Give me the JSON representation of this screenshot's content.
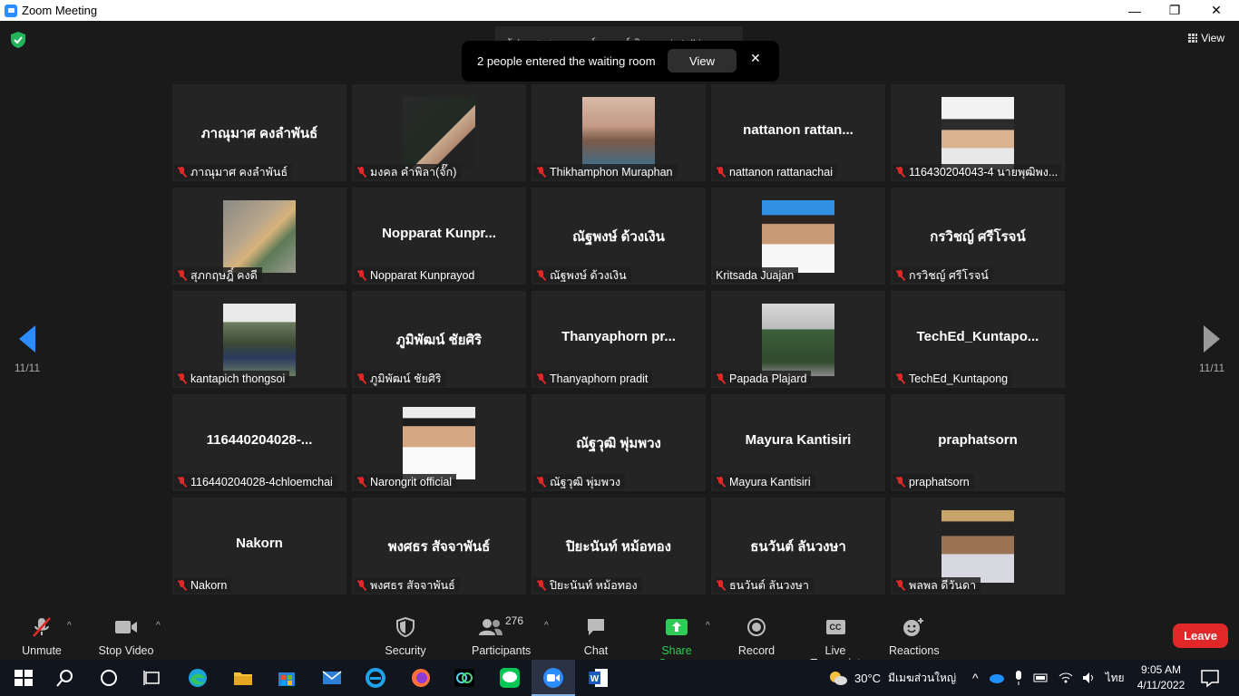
{
  "window": {
    "title": "Zoom Meeting",
    "minimize": "—",
    "maximize": "❐",
    "close": "✕"
  },
  "meeting": {
    "talking": "ผู้ช่วยศาสตราจารย์อานนท์ นิยมผล is talking...",
    "view_label": "View",
    "notice": {
      "text": "2 people entered the waiting room",
      "view": "View",
      "close": "✕"
    },
    "page_indicator": "11/11"
  },
  "tiles": [
    {
      "big": "ภาณุมาศ คงลำพันธ์",
      "label": "ภาณุมาศ คงลำพันธ์",
      "photo": null,
      "muted": true
    },
    {
      "big": "",
      "label": "มงคล คำพิลา(จั๊ก)",
      "photo": "p1",
      "muted": true
    },
    {
      "big": "",
      "label": "Thikhamphon Muraphan",
      "photo": "p2",
      "muted": true
    },
    {
      "big": "nattanon  rattan...",
      "label": "nattanon rattanachai",
      "photo": null,
      "muted": true
    },
    {
      "big": "",
      "label": "116430204043-4 นายพุฒิพง...",
      "photo": "p3",
      "muted": true
    },
    {
      "big": "",
      "label": "สุภกฤษฎิ์ คงดี",
      "photo": "p4",
      "muted": true
    },
    {
      "big": "Nopparat  Kunpr...",
      "label": "Nopparat Kunprayod",
      "photo": null,
      "muted": true
    },
    {
      "big": "ณัฐพงษ์ ด้วงเงิน",
      "label": "ณัฐพงษ์ ด้วงเงิน",
      "photo": null,
      "muted": true
    },
    {
      "big": "",
      "label": "Kritsada Juajan",
      "photo": "p5",
      "muted": false
    },
    {
      "big": "กรวิชญ์ ศรีโรจน์",
      "label": "กรวิชญ์ ศรีโรจน์",
      "photo": null,
      "muted": true
    },
    {
      "big": "",
      "label": "kantapich thongsoi",
      "photo": "p6",
      "muted": true
    },
    {
      "big": "ภูมิพัฒน์  ชัยศิริ",
      "label": "ภูมิพัฒน์  ชัยศิริ",
      "photo": null,
      "muted": true
    },
    {
      "big": "Thanyaphorn  pr...",
      "label": "Thanyaphorn pradit",
      "photo": null,
      "muted": true
    },
    {
      "big": "",
      "label": "Papada Plajard",
      "photo": "p7",
      "muted": true
    },
    {
      "big": "TechEd_Kuntapo...",
      "label": "TechEd_Kuntapong",
      "photo": null,
      "muted": true
    },
    {
      "big": "116440204028-...",
      "label": "116440204028-4chloemchai",
      "photo": null,
      "muted": true
    },
    {
      "big": "",
      "label": "Narongrit official",
      "photo": "p8",
      "muted": true
    },
    {
      "big": "ณัฐวุฒิ พุ่มพวง",
      "label": "ณัฐวุฒิ พุ่มพวง",
      "photo": null,
      "muted": true
    },
    {
      "big": "Mayura Kantisiri",
      "label": "Mayura Kantisiri",
      "photo": null,
      "muted": true
    },
    {
      "big": "praphatsorn",
      "label": "praphatsorn",
      "photo": null,
      "muted": true
    },
    {
      "big": "Nakorn",
      "label": "Nakorn",
      "photo": null,
      "muted": true
    },
    {
      "big": "พงศธร สัจจาพันธ์",
      "label": "พงศธร สัจจาพันธ์",
      "photo": null,
      "muted": true
    },
    {
      "big": "ปิยะนันท์ หม้อทอง",
      "label": "ปิยะนันท์ หม้อทอง",
      "photo": null,
      "muted": true
    },
    {
      "big": "ธนวันต์ ลันวงษา",
      "label": "ธนวันต์ ลันวงษา",
      "photo": null,
      "muted": true
    },
    {
      "big": "",
      "label": "พลพล ดีวันดา",
      "photo": "p9",
      "muted": true
    }
  ],
  "toolbar": {
    "unmute": "Unmute",
    "stop_video": "Stop Video",
    "security": "Security",
    "participants": "Participants",
    "participants_count": "276",
    "chat": "Chat",
    "share_screen": "Share Screen",
    "record": "Record",
    "live_transcript": "Live Transcript",
    "cc": "CC",
    "reactions": "Reactions",
    "leave": "Leave",
    "caret": "^"
  },
  "taskbar": {
    "weather_temp": "30°C",
    "weather_text": "มีเมฆส่วนใหญ่",
    "lang": "ไทย",
    "time": "9:05 AM",
    "date": "4/11/2022"
  },
  "colors": {
    "accent": "#2D8CFF",
    "leave": "#E02828",
    "share": "#2FCB56",
    "muted": "#E02828"
  }
}
